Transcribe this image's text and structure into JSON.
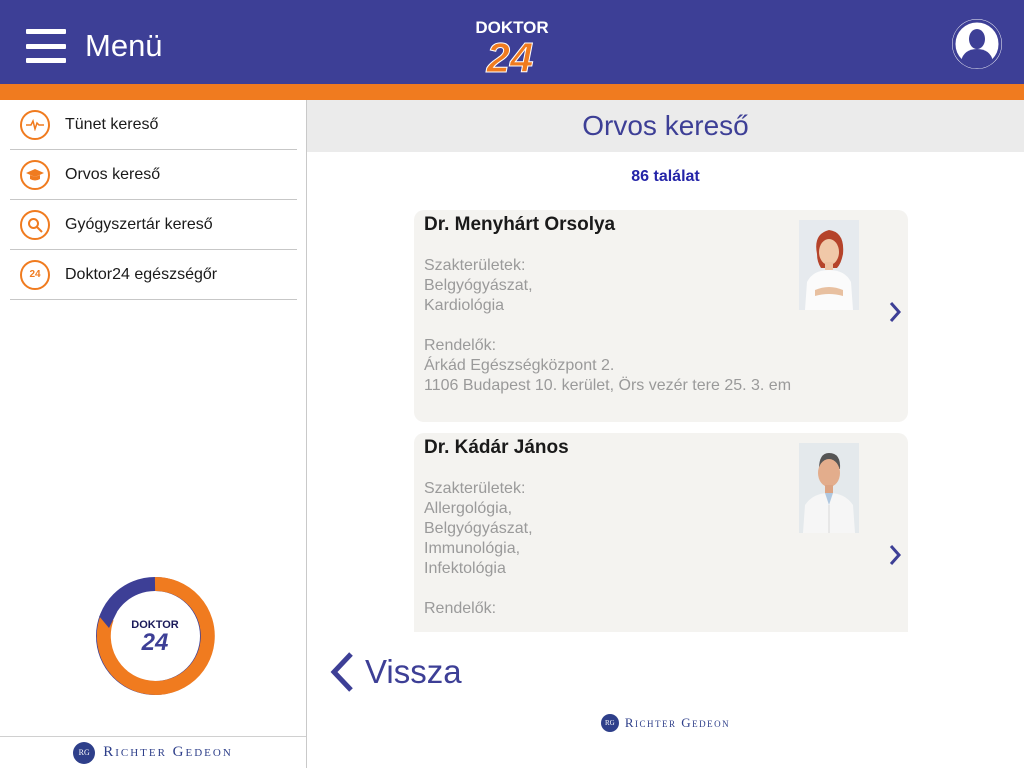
{
  "header": {
    "menu_label": "Menü",
    "logo_text_top": "DOKTOR",
    "logo_text_num": "24",
    "avatar_icon": "user-silhouette-icon"
  },
  "sidebar": {
    "items": [
      {
        "label": "Tünet kereső",
        "icon": "heartbeat-icon"
      },
      {
        "label": "Orvos kereső",
        "icon": "graduation-cap-icon"
      },
      {
        "label": "Gyógyszertár kereső",
        "icon": "magnifier-icon"
      },
      {
        "label": "Doktor24 egészségőr",
        "icon": "24-badge-icon",
        "icon_text": "24"
      }
    ],
    "logo_text_top": "DOKTOR",
    "logo_text_num": "24",
    "footer_seal": "RG",
    "footer_brand": "Richter Gedeon"
  },
  "main": {
    "title": "Orvos kereső",
    "result_count": "86 találat",
    "doctors": [
      {
        "name": "Dr. Menyhárt Orsolya",
        "specialties_label": "Szakterületek:",
        "specialties": [
          "Belgyógyászat,",
          "Kardiológia"
        ],
        "offices_label": "Rendelők:",
        "offices": [
          "Árkád Egészségközpont 2.",
          "1106 Budapest 10. kerület, Örs vezér tere 25. 3. em"
        ]
      },
      {
        "name": "Dr. Kádár János",
        "specialties_label": "Szakterületek:",
        "specialties": [
          "Allergológia,",
          "Belgyógyászat,",
          "Immunológia,",
          "Infektológia"
        ],
        "offices_label": "Rendelők:",
        "offices": []
      }
    ],
    "back_label": "Vissza",
    "footer_seal": "RG",
    "footer_brand": "Richter Gedeon"
  },
  "colors": {
    "header_bg": "#3d3f96",
    "accent_orange": "#f07b1f",
    "title_text": "#3d3f96",
    "result_count": "#2424a8"
  }
}
